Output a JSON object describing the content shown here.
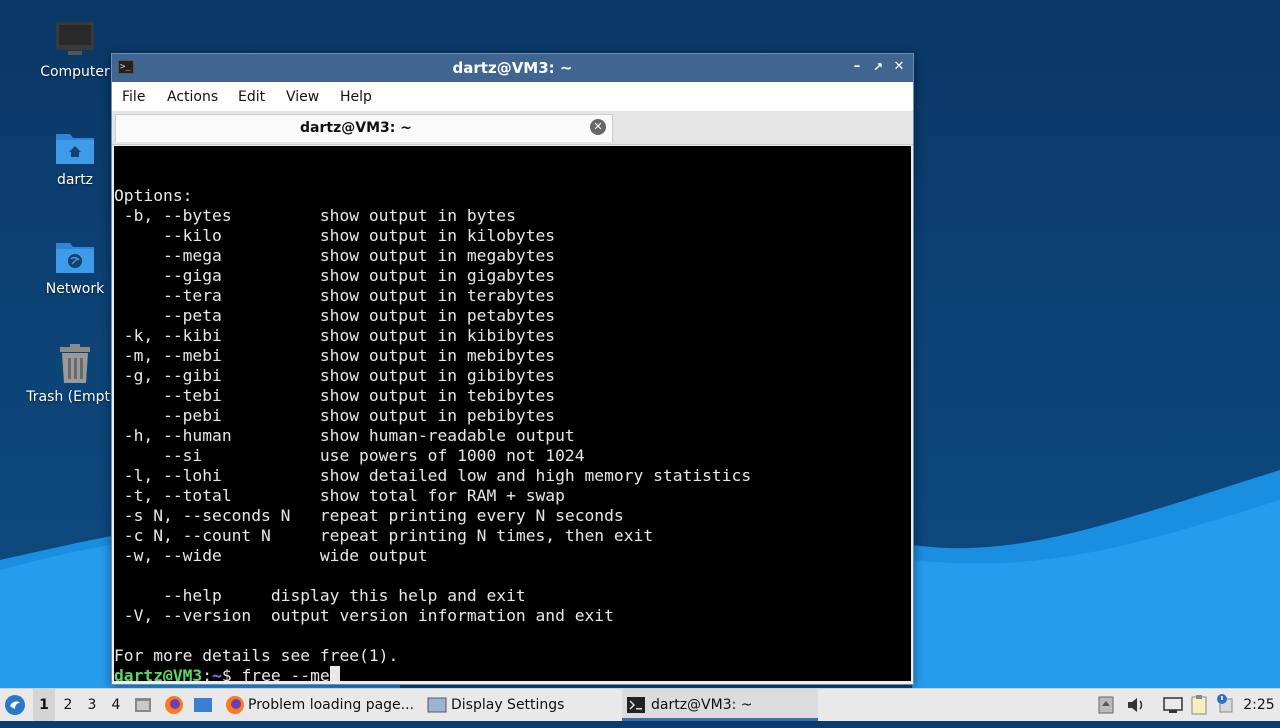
{
  "desktop": {
    "icons": [
      {
        "label": "Computer"
      },
      {
        "label": "dartz"
      },
      {
        "label": "Network"
      },
      {
        "label": "Trash (Empty)"
      }
    ]
  },
  "window": {
    "title": "dartz@VM3: ~",
    "menu": [
      "File",
      "Actions",
      "Edit",
      "View",
      "Help"
    ],
    "tab_title": "dartz@VM3: ~"
  },
  "terminal": {
    "lines": [
      "",
      "Options:",
      " -b, --bytes         show output in bytes",
      "     --kilo          show output in kilobytes",
      "     --mega          show output in megabytes",
      "     --giga          show output in gigabytes",
      "     --tera          show output in terabytes",
      "     --peta          show output in petabytes",
      " -k, --kibi          show output in kibibytes",
      " -m, --mebi          show output in mebibytes",
      " -g, --gibi          show output in gibibytes",
      "     --tebi          show output in tebibytes",
      "     --pebi          show output in pebibytes",
      " -h, --human         show human-readable output",
      "     --si            use powers of 1000 not 1024",
      " -l, --lohi          show detailed low and high memory statistics",
      " -t, --total         show total for RAM + swap",
      " -s N, --seconds N   repeat printing every N seconds",
      " -c N, --count N     repeat printing N times, then exit",
      " -w, --wide          wide output",
      "",
      "     --help     display this help and exit",
      " -V, --version  output version information and exit",
      "",
      "For more details see free(1)."
    ],
    "prompt_user": "dartz@VM3",
    "prompt_sep": ":",
    "prompt_path": "~",
    "prompt_symbol": "$ ",
    "command": "free --me"
  },
  "taskbar": {
    "workspaces": [
      "1",
      "2",
      "3",
      "4"
    ],
    "active_workspace": "1",
    "tasks": [
      {
        "label": "Problem loading page..."
      },
      {
        "label": "Display Settings"
      },
      {
        "label": "dartz@VM3: ~"
      }
    ],
    "clock": "2:25"
  },
  "colors": {
    "accent": "#3f6590",
    "prompt_user": "#5fd75f",
    "prompt_path": "#5f87ff"
  }
}
